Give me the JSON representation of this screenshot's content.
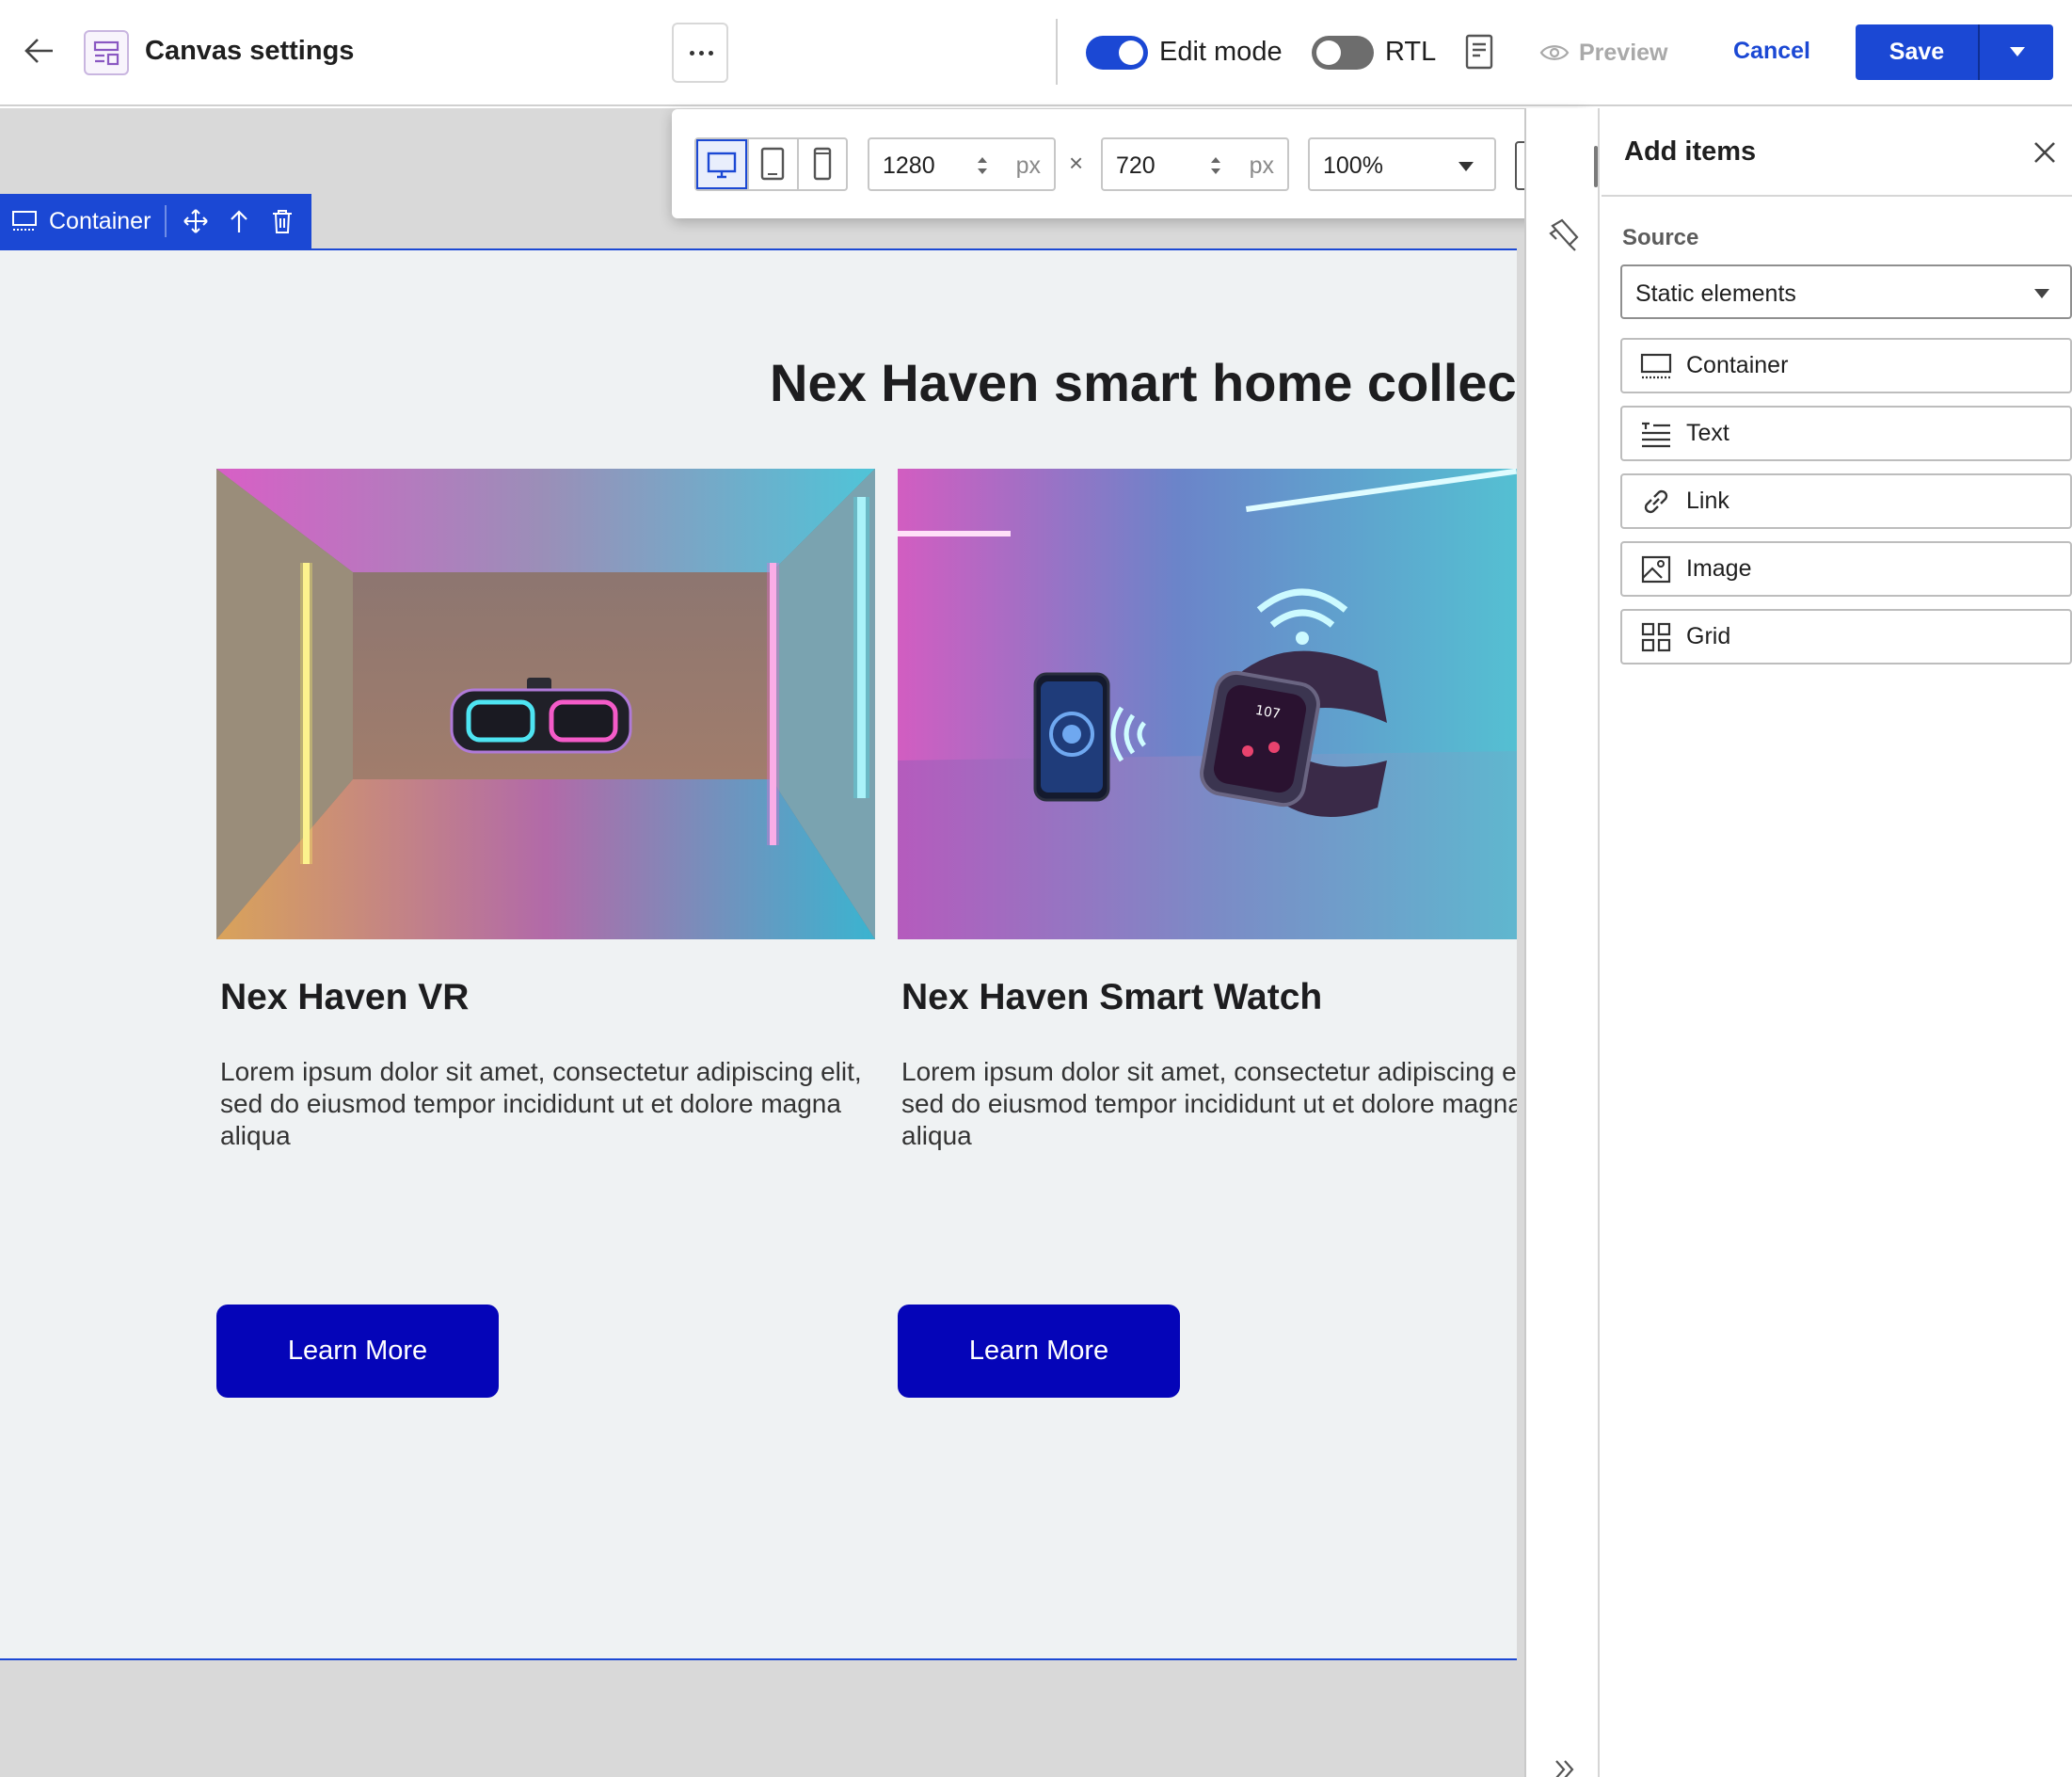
{
  "topbar": {
    "title": "Canvas settings",
    "edit_mode": {
      "label": "Edit mode",
      "on": true
    },
    "rtl": {
      "label": "RTL",
      "on": false
    },
    "preview_label": "Preview",
    "cancel_label": "Cancel",
    "save_label": "Save"
  },
  "viewport": {
    "width": "1280",
    "height": "720",
    "unit": "px",
    "times": "×",
    "zoom": "100%"
  },
  "canvas": {
    "container_tag": "Container",
    "heading": "Nex Haven smart home collection",
    "cards": [
      {
        "title": "Nex Haven VR",
        "description": "Lorem ipsum dolor sit amet, consectetur adipiscing elit, sed do eiusmod tempor incididunt ut et dolore magna aliqua",
        "button": "Learn More"
      },
      {
        "title": "Nex Haven Smart Watch",
        "description": "Lorem ipsum dolor sit amet, consectetur adipiscing elit, sed do eiusmod tempor incididunt ut et dolore magna aliqua",
        "button": "Learn More"
      }
    ]
  },
  "panel": {
    "title": "Add items",
    "source_label": "Source",
    "source_value": "Static elements",
    "items": [
      {
        "label": "Container",
        "icon": "container-icon"
      },
      {
        "label": "Text",
        "icon": "text-icon"
      },
      {
        "label": "Link",
        "icon": "link-icon"
      },
      {
        "label": "Image",
        "icon": "image-icon"
      },
      {
        "label": "Grid",
        "icon": "grid-icon"
      }
    ]
  },
  "colors": {
    "accent": "#1b48d4",
    "cta": "#0505b8",
    "canvas_bg": "#eff2f3"
  }
}
